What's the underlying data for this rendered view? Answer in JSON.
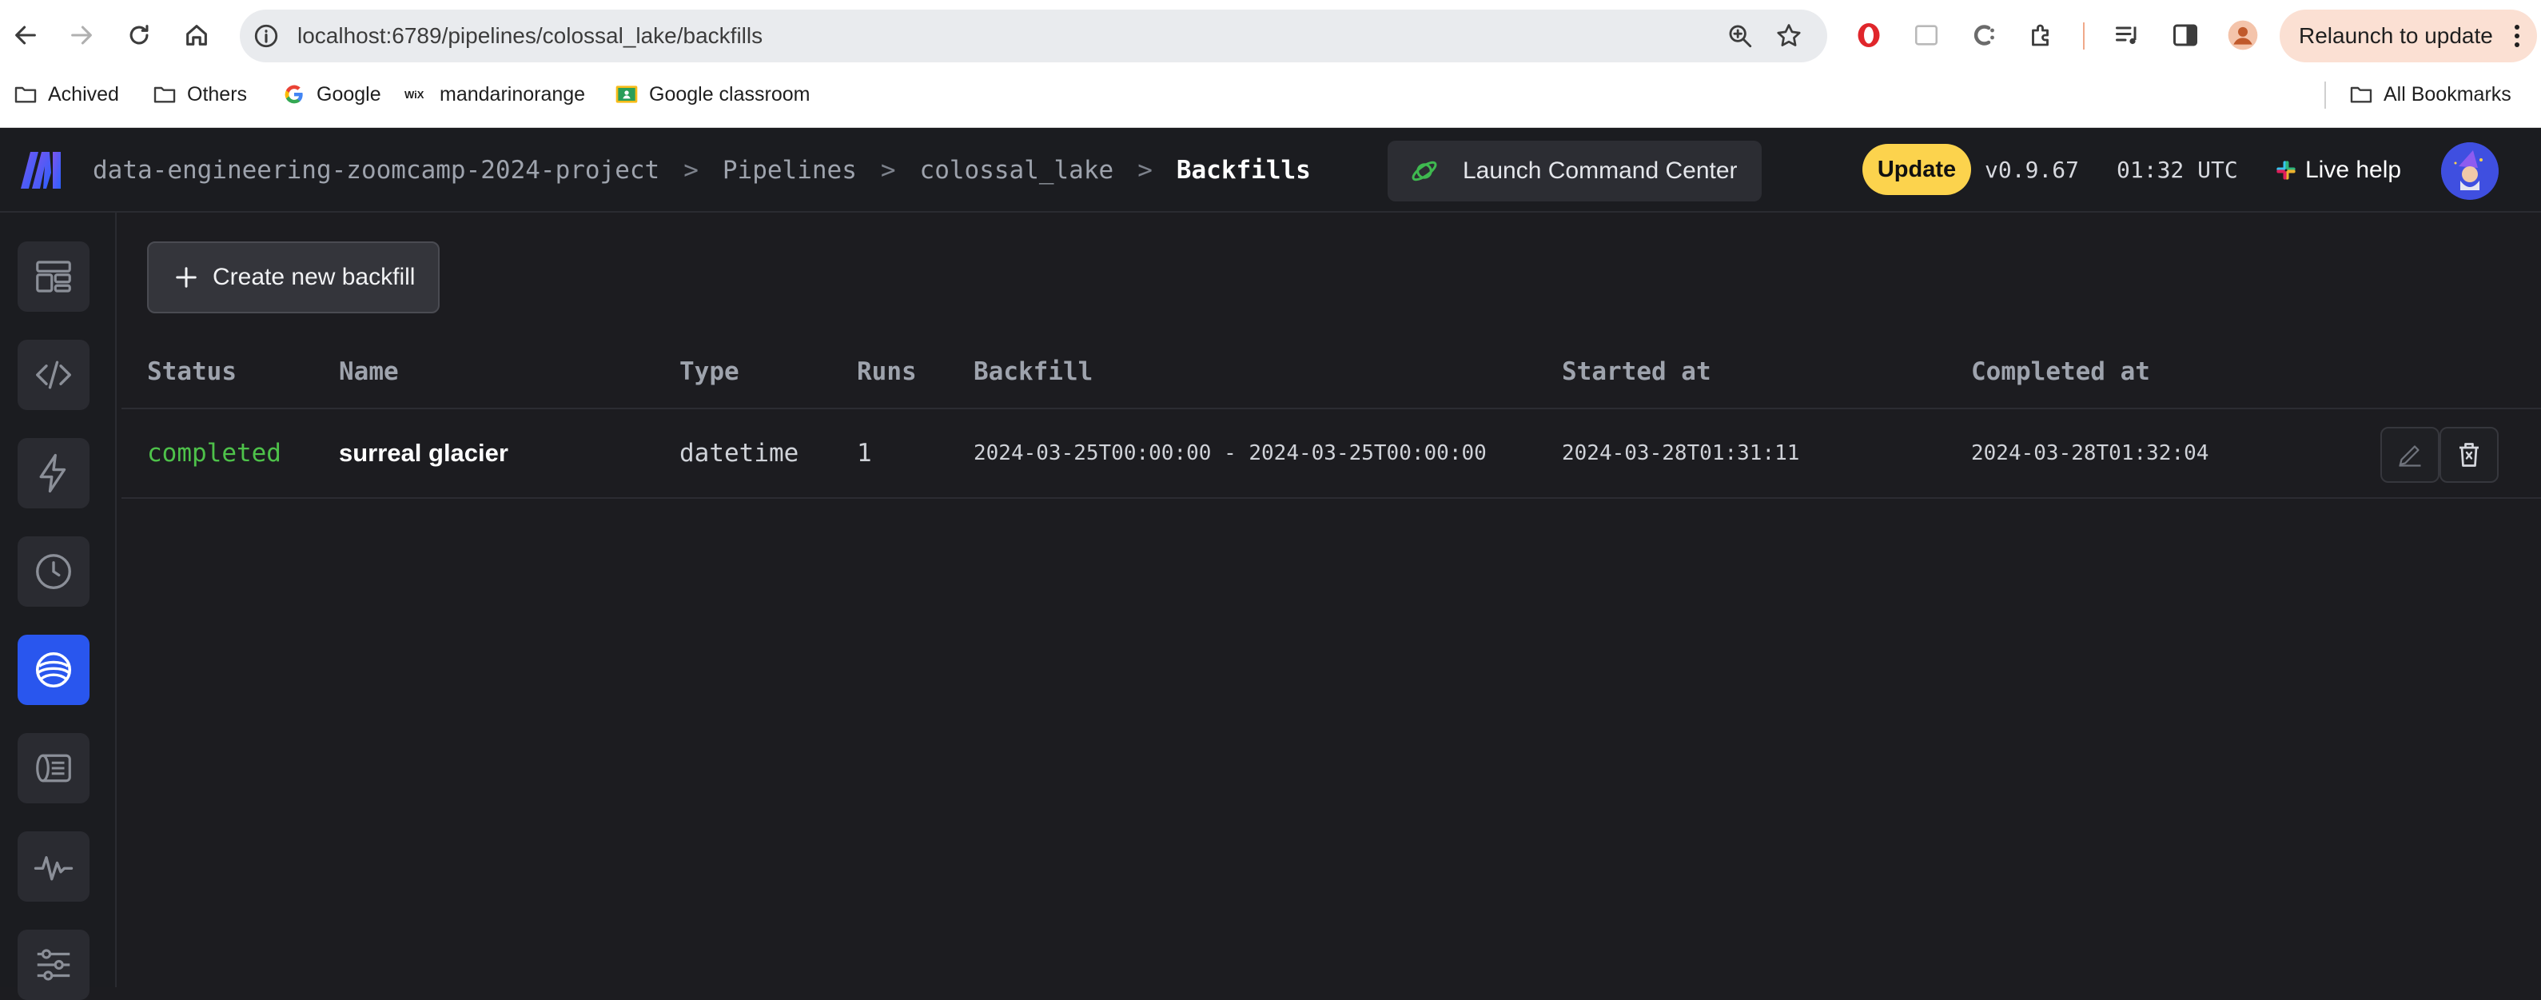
{
  "browser": {
    "url": "localhost:6789/pipelines/colossal_lake/backfills",
    "relaunch_label": "Relaunch to update",
    "bookmarks": [
      "Achived",
      "Others",
      "Google",
      "mandarinorange",
      "Google classroom"
    ],
    "all_bookmarks_label": "All Bookmarks"
  },
  "header": {
    "breadcrumbs": [
      "data-engineering-zoomcamp-2024-project",
      "Pipelines",
      "colossal_lake",
      "Backfills"
    ],
    "separator": ">",
    "command_center_label": "Launch Command Center",
    "update_label": "Update",
    "version": "v0.9.67",
    "time": "01:32 UTC",
    "live_help_label": "Live help"
  },
  "sidebar": {
    "items": [
      "dashboard",
      "code",
      "triggers",
      "runs",
      "backfills",
      "logs",
      "monitor",
      "settings"
    ],
    "active": "backfills"
  },
  "main": {
    "create_label": "Create new backfill",
    "columns": [
      "Status",
      "Name",
      "Type",
      "Runs",
      "Backfill",
      "Started at",
      "Completed at"
    ],
    "rows": [
      {
        "status": "completed",
        "name": "surreal glacier",
        "type": "datetime",
        "runs": "1",
        "backfill": "2024-03-25T00:00:00 - 2024-03-25T00:00:00",
        "started_at": "2024-03-28T01:31:11",
        "completed_at": "2024-03-28T01:32:04"
      }
    ]
  },
  "colors": {
    "accent": "#2956ee",
    "status_completed": "#4ec24a",
    "update_badge": "#fcd34d"
  }
}
